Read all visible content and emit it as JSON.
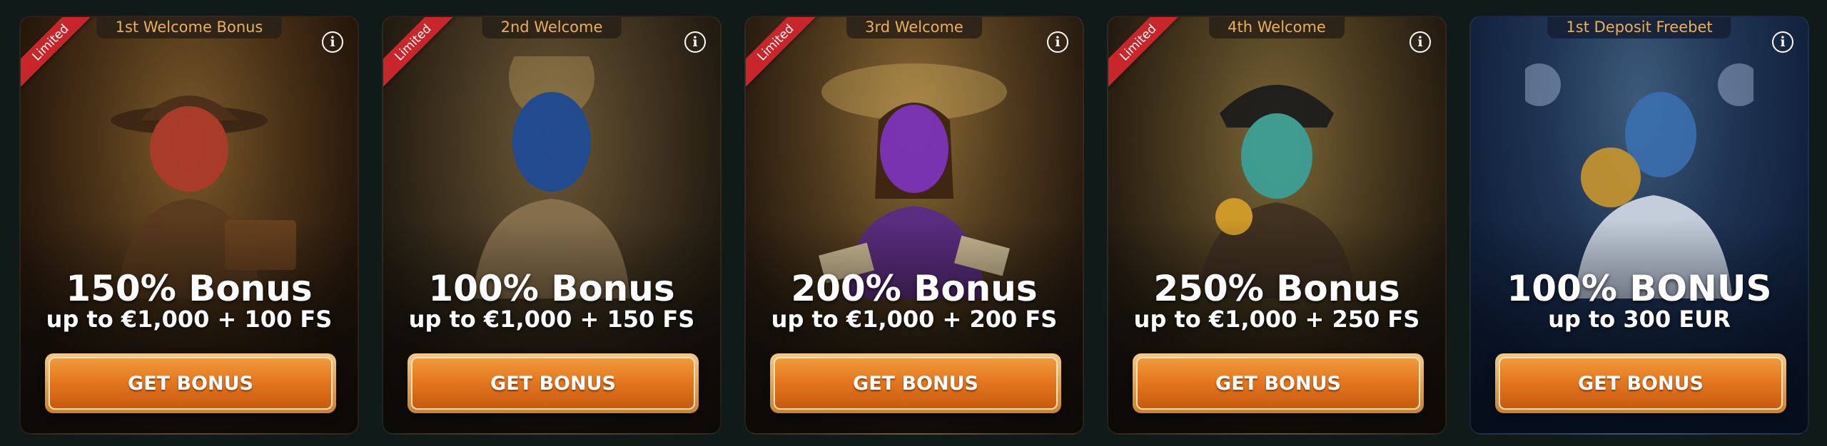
{
  "cards": [
    {
      "tab": "1st Welcome Bonus",
      "ribbon": "Limited",
      "headline": "150% Bonus",
      "subline": "up to €1,000 + 100 FS",
      "button": "GET BONUS",
      "info": "i",
      "figure": "adventurer-illustration"
    },
    {
      "tab": "2nd Welcome",
      "ribbon": "Limited",
      "headline": "100% Bonus",
      "subline": "up to €1,000 + 150 FS",
      "button": "GET BONUS",
      "info": "i",
      "figure": "explorer-illustration"
    },
    {
      "tab": "3rd Welcome",
      "ribbon": "Limited",
      "headline": "200% Bonus",
      "subline": "up to €1,000 + 200 FS",
      "button": "GET BONUS",
      "info": "i",
      "figure": "woman-with-cash-illustration"
    },
    {
      "tab": "4th Welcome",
      "ribbon": "Limited",
      "headline": "250% Bonus",
      "subline": "up to €1,000 + 250 FS",
      "button": "GET BONUS",
      "info": "i",
      "figure": "pirate-illustration"
    },
    {
      "tab": "1st Deposit Freebet",
      "headline": "100% BONUS",
      "subline": "up to 300 EUR",
      "button": "GET BONUS",
      "info": "i",
      "figure": "footballer-illustration"
    }
  ],
  "colors": {
    "tab_text": "#e9b05a",
    "ribbon": "#c8262b",
    "button_top": "#f09a3c",
    "button_bottom": "#c75a10",
    "background": "#0f1a19"
  }
}
